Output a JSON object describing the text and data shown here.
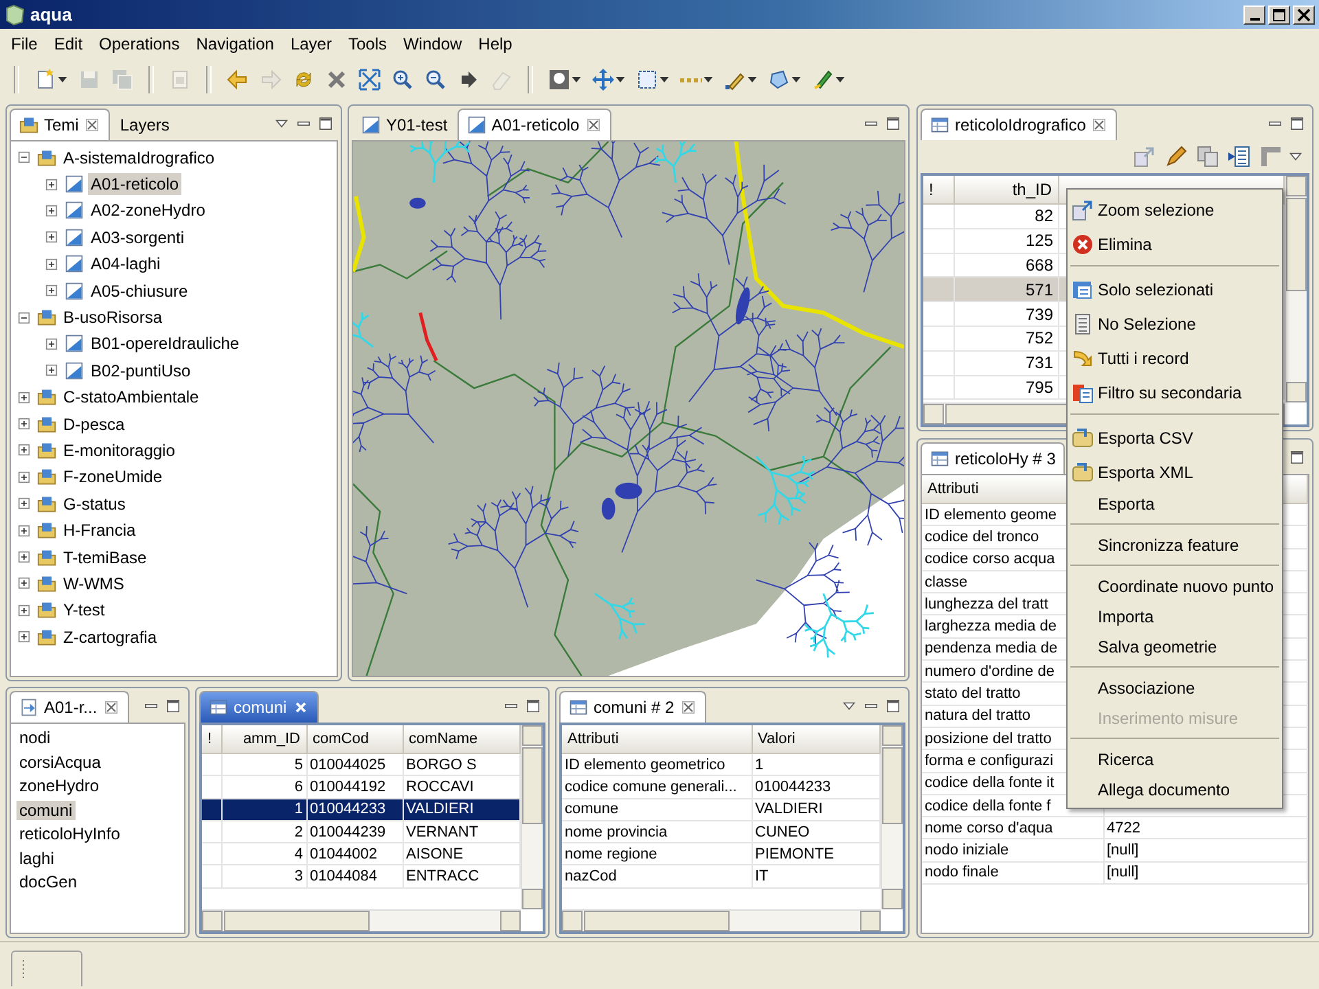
{
  "window": {
    "title": "aqua"
  },
  "menu": [
    "File",
    "Edit",
    "Operations",
    "Navigation",
    "Layer",
    "Tools",
    "Window",
    "Help"
  ],
  "toolbar": {
    "groups": [
      {
        "items": [
          {
            "kind": "new",
            "disabled": false,
            "dropdown": true
          },
          {
            "kind": "save",
            "disabled": true,
            "dropdown": false
          },
          {
            "kind": "save-all",
            "disabled": true,
            "dropdown": false
          }
        ]
      },
      {
        "items": [
          {
            "kind": "document",
            "disabled": true,
            "dropdown": false
          }
        ]
      },
      {
        "items": [
          {
            "kind": "back",
            "disabled": false,
            "dropdown": false
          },
          {
            "kind": "forward",
            "disabled": true,
            "dropdown": false
          },
          {
            "kind": "refresh",
            "disabled": false,
            "dropdown": false
          },
          {
            "kind": "clear",
            "disabled": false,
            "dropdown": false
          },
          {
            "kind": "extent",
            "disabled": false,
            "dropdown": false
          },
          {
            "kind": "zoom-in",
            "disabled": false,
            "dropdown": false
          },
          {
            "kind": "zoom-out",
            "disabled": false,
            "dropdown": false
          },
          {
            "kind": "next",
            "disabled": false,
            "dropdown": false
          },
          {
            "kind": "eraser",
            "disabled": true,
            "dropdown": false
          }
        ]
      },
      {
        "items": [
          {
            "kind": "light",
            "disabled": false,
            "dropdown": true
          },
          {
            "kind": "pan",
            "disabled": false,
            "dropdown": true
          },
          {
            "kind": "select",
            "disabled": false,
            "dropdown": true
          },
          {
            "kind": "measure",
            "disabled": false,
            "dropdown": true
          },
          {
            "kind": "edit",
            "disabled": false,
            "dropdown": true
          },
          {
            "kind": "polygon",
            "disabled": false,
            "dropdown": true
          },
          {
            "kind": "draw",
            "disabled": false,
            "dropdown": true
          }
        ]
      }
    ]
  },
  "themes_panel": {
    "focused": false,
    "tabs": [
      {
        "label": "Temi",
        "kind": "themes",
        "selected": true,
        "closable": true
      },
      {
        "label": "Layers",
        "kind": "plain",
        "selected": false,
        "closable": false
      }
    ],
    "tree": [
      {
        "label": "A-sistemaIdrografico",
        "kind": "theme",
        "expanded": true,
        "selected": false,
        "children": [
          {
            "label": "A01-reticolo",
            "kind": "layer",
            "expanded": false,
            "selected": true
          },
          {
            "label": "A02-zoneHydro",
            "kind": "layer",
            "expanded": false,
            "selected": false
          },
          {
            "label": "A03-sorgenti",
            "kind": "layer",
            "expanded": false,
            "selected": false
          },
          {
            "label": "A04-laghi",
            "kind": "layer",
            "expanded": false,
            "selected": false
          },
          {
            "label": "A05-chiusure",
            "kind": "layer",
            "expanded": false,
            "selected": false
          }
        ]
      },
      {
        "label": "B-usoRisorsa",
        "kind": "theme",
        "expanded": true,
        "selected": false,
        "children": [
          {
            "label": "B01-opereIdrauliche",
            "kind": "layer",
            "expanded": false,
            "selected": false
          },
          {
            "label": "B02-puntiUso",
            "kind": "layer",
            "expanded": false,
            "selected": false
          }
        ]
      },
      {
        "label": "C-statoAmbientale",
        "kind": "theme",
        "expanded": false,
        "selected": false
      },
      {
        "label": "D-pesca",
        "kind": "theme",
        "expanded": false,
        "selected": false
      },
      {
        "label": "E-monitoraggio",
        "kind": "theme",
        "expanded": false,
        "selected": false
      },
      {
        "label": "F-zoneUmide",
        "kind": "theme",
        "expanded": false,
        "selected": false
      },
      {
        "label": "G-status",
        "kind": "theme",
        "expanded": false,
        "selected": false
      },
      {
        "label": "H-Francia",
        "kind": "theme",
        "expanded": false,
        "selected": false
      },
      {
        "label": "T-temiBase",
        "kind": "theme",
        "expanded": false,
        "selected": false
      },
      {
        "label": "W-WMS",
        "kind": "theme",
        "expanded": false,
        "selected": false
      },
      {
        "label": "Y-test",
        "kind": "theme",
        "expanded": false,
        "selected": false
      },
      {
        "label": "Z-cartografia",
        "kind": "theme",
        "expanded": false,
        "selected": false
      }
    ]
  },
  "map_panel": {
    "focused": false,
    "tabs": [
      {
        "label": "Y01-test",
        "kind": "map",
        "selected": false,
        "closable": false
      },
      {
        "label": "A01-reticolo",
        "kind": "map",
        "selected": true,
        "closable": true
      }
    ]
  },
  "outline_panel": {
    "focused": false,
    "tabs": [
      {
        "label": "A01-r...",
        "kind": "outline",
        "selected": true,
        "closable": true
      }
    ],
    "items": [
      {
        "label": "nodi",
        "selected": false
      },
      {
        "label": "corsiAcqua",
        "selected": false
      },
      {
        "label": "zoneHydro",
        "selected": false
      },
      {
        "label": "comuni",
        "selected": true
      },
      {
        "label": "reticoloHyInfo",
        "selected": false
      },
      {
        "label": "laghi",
        "selected": false
      },
      {
        "label": "docGen",
        "selected": false
      }
    ]
  },
  "comuni_panel": {
    "focused": true,
    "tabs": [
      {
        "label": "comuni",
        "kind": "table",
        "selected": true,
        "closable": true
      }
    ],
    "columns": [
      "!",
      "amm_ID",
      "comCod",
      "comName"
    ],
    "rows": [
      {
        "cells": [
          "",
          "5",
          "010044025",
          "BORGO S"
        ],
        "selected": false
      },
      {
        "cells": [
          "",
          "6",
          "010044192",
          "ROCCAVI"
        ],
        "selected": false
      },
      {
        "cells": [
          "",
          "1",
          "010044233",
          "VALDIERI"
        ],
        "selected": true
      },
      {
        "cells": [
          "",
          "2",
          "010044239",
          "VERNANT"
        ],
        "selected": false
      },
      {
        "cells": [
          "",
          "4",
          "01044002",
          "AISONE"
        ],
        "selected": false
      },
      {
        "cells": [
          "",
          "3",
          "01044084",
          "ENTRACC"
        ],
        "selected": false
      }
    ]
  },
  "comuni_attr_panel": {
    "focused": false,
    "tabs": [
      {
        "label": "comuni # 2",
        "kind": "table",
        "selected": true,
        "closable": true
      }
    ],
    "columns": [
      "Attributi",
      "Valori"
    ],
    "rows": [
      {
        "attribute": "ID elemento geometrico",
        "value": "1"
      },
      {
        "attribute": "codice comune generali...",
        "value": "010044233"
      },
      {
        "attribute": "comune",
        "value": "VALDIERI"
      },
      {
        "attribute": "nome provincia",
        "value": "CUNEO"
      },
      {
        "attribute": "nome regione",
        "value": "PIEMONTE"
      },
      {
        "attribute": "nazCod",
        "value": "IT"
      }
    ]
  },
  "reticolo_panel": {
    "focused": false,
    "tabs": [
      {
        "label": "reticoloIdrografico",
        "kind": "table",
        "selected": true,
        "closable": true
      }
    ],
    "columns": [
      "!",
      "th_ID"
    ],
    "rows": [
      {
        "cells": [
          "",
          "82"
        ],
        "selected": false
      },
      {
        "cells": [
          "",
          "125"
        ],
        "selected": false
      },
      {
        "cells": [
          "",
          "668"
        ],
        "selected": false
      },
      {
        "cells": [
          "",
          "571"
        ],
        "selected": true
      },
      {
        "cells": [
          "",
          "739"
        ],
        "selected": false
      },
      {
        "cells": [
          "",
          "752"
        ],
        "selected": false
      },
      {
        "cells": [
          "",
          "731"
        ],
        "selected": false
      },
      {
        "cells": [
          "",
          "795"
        ],
        "selected": false
      }
    ]
  },
  "reticolo_attr_panel": {
    "focused": false,
    "tabs": [
      {
        "label": "reticoloHy # 3",
        "kind": "table",
        "selected": true,
        "closable": false
      }
    ],
    "columns": [
      "Attributi"
    ],
    "rows": [
      {
        "attribute": "ID elemento geome"
      },
      {
        "attribute": "codice del tronco"
      },
      {
        "attribute": "codice corso acqua"
      },
      {
        "attribute": "classe"
      },
      {
        "attribute": "lunghezza del tratt"
      },
      {
        "attribute": "larghezza media de"
      },
      {
        "attribute": "pendenza media de"
      },
      {
        "attribute": "numero d'ordine de"
      },
      {
        "attribute": "stato del tratto"
      },
      {
        "attribute": "natura del tratto"
      },
      {
        "attribute": "posizione del tratto"
      },
      {
        "attribute": "forma e configurazi"
      },
      {
        "attribute": "codice della fonte it"
      },
      {
        "attribute": "codice della fonte f"
      },
      {
        "attribute": "nome corso d'aqua",
        "value": "4722"
      },
      {
        "attribute": "nodo iniziale",
        "value": "[null]"
      },
      {
        "attribute": "nodo finale",
        "value": "[null]"
      }
    ]
  },
  "context_menu": {
    "sections": [
      {
        "items": [
          {
            "label": "Zoom selezione",
            "kind": "zoom",
            "disabled": false
          },
          {
            "label": "Elimina",
            "kind": "delete",
            "disabled": false
          }
        ]
      },
      {
        "items": [
          {
            "label": "Solo selezionati",
            "kind": "filter",
            "disabled": false
          },
          {
            "label": "No Selezione",
            "kind": "deselect",
            "disabled": false
          },
          {
            "label": "Tutti i record",
            "kind": "all",
            "disabled": false
          },
          {
            "label": "Filtro su secondaria",
            "kind": "secondary",
            "disabled": false
          }
        ]
      },
      {
        "items": [
          {
            "label": "Esporta CSV",
            "kind": "export",
            "disabled": false
          },
          {
            "label": "Esporta XML",
            "kind": "export",
            "disabled": false
          },
          {
            "label": "Esporta",
            "kind": "plain",
            "disabled": false
          }
        ]
      },
      {
        "items": [
          {
            "label": "Sincronizza feature",
            "kind": "plain",
            "disabled": false
          }
        ]
      },
      {
        "items": [
          {
            "label": "Coordinate nuovo punto",
            "kind": "plain",
            "disabled": false
          },
          {
            "label": "Importa",
            "kind": "plain",
            "disabled": false
          },
          {
            "label": "Salva geometrie",
            "kind": "plain",
            "disabled": false
          }
        ]
      },
      {
        "items": [
          {
            "label": "Associazione",
            "kind": "plain",
            "disabled": false
          },
          {
            "label": "Inserimento misure",
            "kind": "plain",
            "disabled": true
          }
        ]
      },
      {
        "items": [
          {
            "label": "Ricerca",
            "kind": "plain",
            "disabled": false
          },
          {
            "label": "Allega documento",
            "kind": "plain",
            "disabled": false
          }
        ]
      }
    ]
  }
}
